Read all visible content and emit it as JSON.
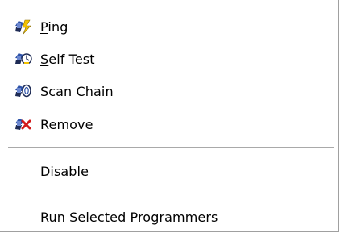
{
  "menu": {
    "items": [
      {
        "pre": "",
        "acc": "P",
        "post": "ing",
        "icon": "ping-icon"
      },
      {
        "pre": "",
        "acc": "S",
        "post": "elf Test",
        "icon": "self-test-icon"
      },
      {
        "pre": "Scan ",
        "acc": "C",
        "post": "hain",
        "icon": "scan-chain-icon"
      },
      {
        "pre": "",
        "acc": "R",
        "post": "emove",
        "icon": "remove-icon"
      }
    ],
    "disable": "Disable",
    "run_selected": "Run Selected Programmers"
  },
  "colors": {
    "icon_blue": "#2d52a8",
    "icon_dark": "#1e2b55",
    "ping_yellow": "#f2c200",
    "remove_red": "#d21919",
    "separator": "#a9a9a9"
  }
}
